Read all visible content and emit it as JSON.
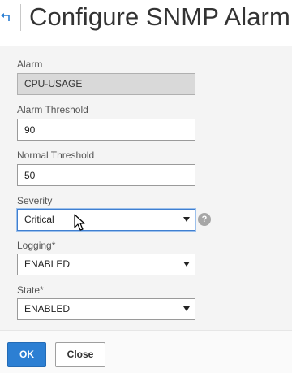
{
  "header": {
    "back_icon": "back-arrow-icon",
    "title": "Configure SNMP Alarm"
  },
  "form": {
    "alarm": {
      "label": "Alarm",
      "value": "CPU-USAGE"
    },
    "alarm_threshold": {
      "label": "Alarm Threshold",
      "value": "90"
    },
    "normal_threshold": {
      "label": "Normal Threshold",
      "value": "50"
    },
    "severity": {
      "label": "Severity",
      "value": "Critical",
      "help": "?"
    },
    "logging": {
      "label": "Logging*",
      "value": "ENABLED"
    },
    "state": {
      "label": "State*",
      "value": "ENABLED"
    }
  },
  "footer": {
    "ok_label": "OK",
    "close_label": "Close"
  },
  "colors": {
    "primary_button": "#2c7fd3",
    "focus_border": "#3f7fd0",
    "form_background": "#f4f4f4"
  }
}
